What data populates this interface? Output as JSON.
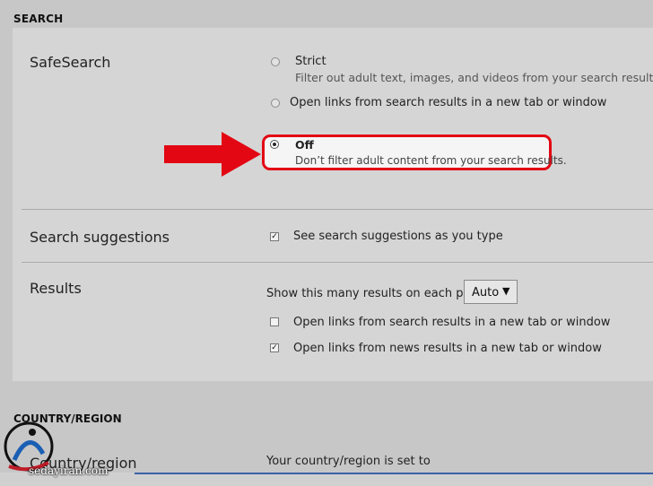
{
  "search_section": {
    "header": "SEARCH",
    "safesearch": {
      "label": "SafeSearch",
      "options": [
        {
          "title": "Strict",
          "description": "Filter out adult text, images, and videos from your search results.",
          "checked": false
        },
        {
          "title": "Open links from search results in a new tab or window",
          "description": "",
          "checked": false
        },
        {
          "title": "Off",
          "description": "Don’t filter adult content from your search results.",
          "checked": true
        }
      ]
    },
    "suggestions": {
      "label": "Search suggestions",
      "checkbox_label": "See search suggestions as you type",
      "checked": true
    },
    "results": {
      "label": "Results",
      "count_label": "Show this many results on each page",
      "count_value": "Auto",
      "options": [
        {
          "label": "Open links from search results in a new tab or window",
          "checked": false
        },
        {
          "label": "Open links from news results in a new tab or window",
          "checked": true
        }
      ]
    }
  },
  "country_section": {
    "header": "COUNTRY/REGION",
    "label": "Country/region",
    "value_text": "Your country/region is set to"
  },
  "annotation": {
    "arrow_color": "#e30613",
    "highlight_color": "#e30613"
  },
  "watermark": {
    "text": "sedayiran.com"
  }
}
